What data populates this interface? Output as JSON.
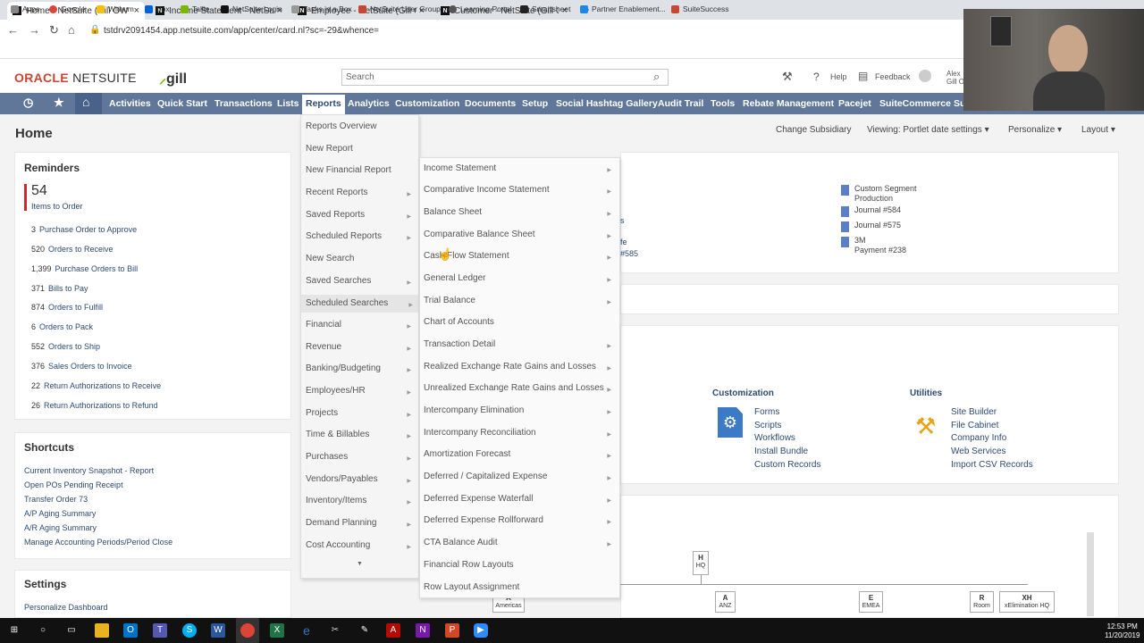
{
  "tabs": [
    {
      "label": "Home - NetSuite (Gill OW WD U",
      "active": true
    },
    {
      "label": "Income Statement - NetSuite (Gill",
      "active": false
    },
    {
      "label": "Employee - NetSuite (Gill OW W",
      "active": false
    },
    {
      "label": "Customer - NetSuite (Gill OW W",
      "active": false
    }
  ],
  "address": {
    "url": "tstdrv2091454.app.netsuite.com/app/center/card.nl?sc=-29&whence="
  },
  "bookmarks": [
    "Apps",
    "Google",
    "Withum",
    "Box",
    "Tallie",
    "NetSuite Login",
    "Tasks in a Box",
    "NetSuite User Group",
    "Learning Portal",
    "Smartsheet",
    "Partner Enablement...",
    "SuiteSuccess"
  ],
  "header": {
    "logo_oracle": "ORACLE",
    "logo_netsuite": " NETSUITE",
    "brand": "gill",
    "search_placeholder": "Search",
    "help": "Help",
    "feedback": "Feedback",
    "user_line1": "Alex",
    "user_line2": "Gill O"
  },
  "menu": [
    "Activities",
    "Quick Start",
    "Transactions",
    "Lists",
    "Reports",
    "Analytics",
    "Customization",
    "Documents",
    "Setup",
    "Social Hashtag Gallery",
    "Audit Trail",
    "Tools",
    "Rebate Management",
    "Pacejet",
    "SuiteCommerce",
    "Su"
  ],
  "page": {
    "title": "Home",
    "change_subsidiary": "Change Subsidiary",
    "viewing": "Viewing: Portlet date settings",
    "personalize": "Personalize",
    "layout": "Layout"
  },
  "reminders": {
    "title": "Reminders",
    "count": "54",
    "count_label": "Items to Order",
    "items": [
      {
        "n": "3",
        "label": "Purchase Order to Approve"
      },
      {
        "n": "520",
        "label": "Orders to Receive"
      },
      {
        "n": "1,399",
        "label": "Purchase Orders to Bill"
      },
      {
        "n": "371",
        "label": "Bills to Pay"
      },
      {
        "n": "874",
        "label": "Orders to Fulfill"
      },
      {
        "n": "6",
        "label": "Orders to Pack"
      },
      {
        "n": "552",
        "label": "Orders to Ship"
      },
      {
        "n": "376",
        "label": "Sales Orders to Invoice"
      },
      {
        "n": "22",
        "label": "Return Authorizations to Receive"
      },
      {
        "n": "26",
        "label": "Return Authorizations to Refund"
      }
    ]
  },
  "shortcuts": {
    "title": "Shortcuts",
    "items": [
      "Current Inventory Snapshot - Report",
      "Open POs Pending Receipt",
      "Transfer Order 73",
      "A/P Aging Summary",
      "A/R Aging Summary",
      "Manage Accounting Periods/Period Close"
    ]
  },
  "settings": {
    "title": "Settings",
    "items": [
      "Personalize Dashboard"
    ]
  },
  "reports_menu": [
    "Reports Overview",
    "New Report",
    "New Financial Report",
    "Recent Reports",
    "Saved Reports",
    "Scheduled Reports",
    "New Search",
    "Saved Searches",
    "Scheduled Searches",
    "Financial",
    "Revenue",
    "Banking/Budgeting",
    "Employees/HR",
    "Projects",
    "Time & Billables",
    "Purchases",
    "Vendors/Payables",
    "Inventory/Items",
    "Demand Planning",
    "Cost Accounting"
  ],
  "financial_menu": [
    "Income Statement",
    "Comparative Income Statement",
    "Balance Sheet",
    "Comparative Balance Sheet",
    "Cash Flow Statement",
    "General Ledger",
    "Trial Balance",
    "Chart of Accounts",
    "Transaction Detail",
    "Realized Exchange Rate Gains and Losses",
    "Unrealized Exchange Rate Gains and Losses",
    "Intercompany Elimination",
    "Intercompany Reconciliation",
    "Amortization Forecast",
    "Deferred / Capitalized Expense",
    "Deferred Expense Waterfall",
    "Deferred Expense Rollforward",
    "CTA Balance Audit",
    "Financial Row Layouts",
    "Row Layout Assignment"
  ],
  "recent": {
    "partial": [
      "s",
      "fe",
      "#585"
    ],
    "items": [
      "Custom Segment",
      "Production",
      "Journal #584",
      "Journal #575",
      "3M",
      "Payment #238"
    ]
  },
  "customization": {
    "title": "Customization",
    "links": [
      "Forms",
      "Scripts",
      "Workflows",
      "Install Bundle",
      "Custom Records"
    ]
  },
  "utilities": {
    "title": "Utilities",
    "links": [
      "Site Builder",
      "File Cabinet",
      "Company Info",
      "Web Services",
      "Import CSV Records"
    ]
  },
  "org_chart": {
    "nodes": [
      {
        "code": "H",
        "name": "HQ"
      },
      {
        "code": "A",
        "name": "Americas"
      },
      {
        "code": "A",
        "name": "ANZ"
      },
      {
        "code": "E",
        "name": "EMEA"
      },
      {
        "code": "R",
        "name": "Room"
      },
      {
        "code": "XH",
        "name": "xElimination HQ"
      }
    ]
  },
  "clock": {
    "time": "12:53 PM",
    "date": "11/20/2019"
  },
  "colors": {
    "menubar": "#607799",
    "brand_red": "#c74634",
    "link": "#2d4b73",
    "reminder_bar": "#d5262f"
  }
}
